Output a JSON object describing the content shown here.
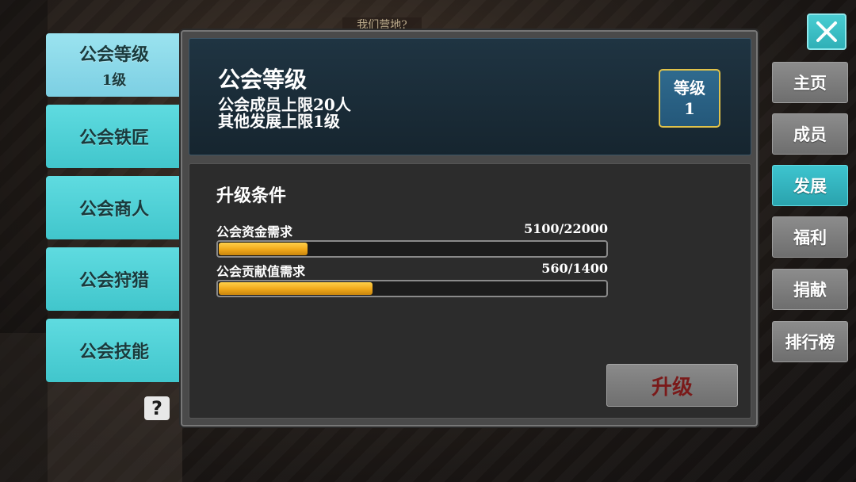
{
  "background": {
    "top_label": "我们营地?"
  },
  "left_tabs": [
    {
      "label": "公会等级",
      "sub": "1级",
      "active": true
    },
    {
      "label": "公会铁匠",
      "sub": "",
      "active": false
    },
    {
      "label": "公会商人",
      "sub": "",
      "active": false
    },
    {
      "label": "公会狩猎",
      "sub": "",
      "active": false
    },
    {
      "label": "公会技能",
      "sub": "",
      "active": false
    }
  ],
  "help": {
    "icon": "question-icon",
    "glyph": "?"
  },
  "panel": {
    "title": "公会等级",
    "line1": "公会成员上限20人",
    "line2": "其他发展上限1级",
    "level_badge": {
      "label": "等级",
      "value": "1"
    },
    "conditions_title": "升级条件",
    "requirements": [
      {
        "label": "公会资金需求",
        "value": "5100/22000",
        "progress": 0.232
      },
      {
        "label": "公会贡献值需求",
        "value": "560/1400",
        "progress": 0.4
      }
    ],
    "upgrade_label": "升级"
  },
  "right_nav": [
    {
      "label": "主页",
      "active": false
    },
    {
      "label": "成员",
      "active": false
    },
    {
      "label": "发展",
      "active": true
    },
    {
      "label": "福利",
      "active": false
    },
    {
      "label": "捐献",
      "active": false
    },
    {
      "label": "排行榜",
      "active": false
    }
  ],
  "close": {
    "icon": "close-icon"
  },
  "colors": {
    "accent_teal": "#41c6cc",
    "progress_gold": "#f0a81a",
    "badge_border": "#e0c24a",
    "upgrade_text": "#7a1a1a"
  }
}
